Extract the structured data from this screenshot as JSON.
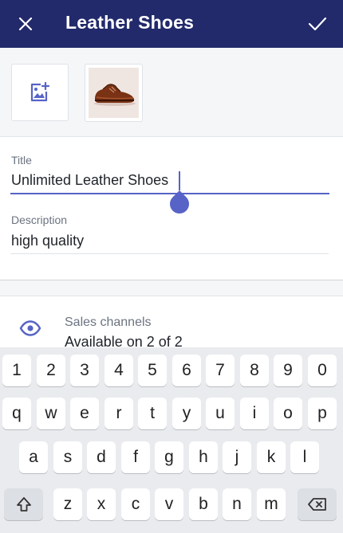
{
  "app_bar": {
    "title": "Leather Shoes",
    "close_icon": "close-icon",
    "confirm_icon": "check-icon",
    "background_color": "#222a6b"
  },
  "media": {
    "add_icon": "add-image-icon",
    "thumbnail_icon": "leather-shoe-image"
  },
  "form": {
    "title_label": "Title",
    "title_value": "Unlimited Leather Shoes",
    "description_label": "Description",
    "description_value": "high quality"
  },
  "sales_channels": {
    "icon": "eye-icon",
    "label": "Sales channels",
    "value": "Available on 2 of 2"
  },
  "keyboard": {
    "row1": [
      "1",
      "2",
      "3",
      "4",
      "5",
      "6",
      "7",
      "8",
      "9",
      "0"
    ],
    "row2": [
      "q",
      "w",
      "e",
      "r",
      "t",
      "y",
      "u",
      "i",
      "o",
      "p"
    ],
    "row3": [
      "a",
      "s",
      "d",
      "f",
      "g",
      "h",
      "j",
      "k",
      "l"
    ],
    "row4": [
      "z",
      "x",
      "c",
      "v",
      "b",
      "n",
      "m"
    ],
    "shift_icon": "shift-icon",
    "backspace_icon": "backspace-icon"
  },
  "accent_color": "#5763c6"
}
